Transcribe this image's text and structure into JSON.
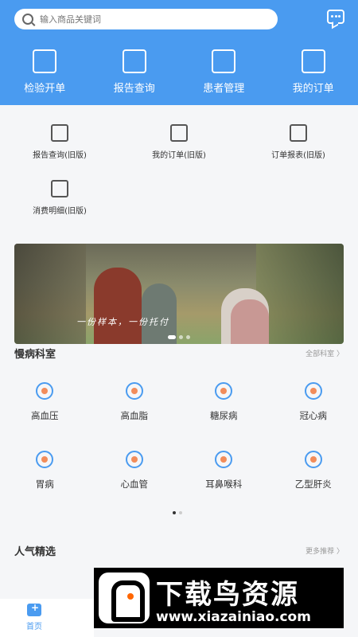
{
  "search": {
    "placeholder": "输入商品关键词"
  },
  "top_nav": [
    {
      "label": "检验开单",
      "icon": "download-box-icon"
    },
    {
      "label": "报告查询",
      "icon": "report-search-icon"
    },
    {
      "label": "患者管理",
      "icon": "layers-icon"
    },
    {
      "label": "我的订单",
      "icon": "checklist-icon"
    }
  ],
  "sub_grid": [
    {
      "label": "报告查询(旧版)",
      "icon": "report-search-icon"
    },
    {
      "label": "我的订单(旧版)",
      "icon": "order-search-icon"
    },
    {
      "label": "订单报表(旧版)",
      "icon": "clipboard-icon"
    },
    {
      "label": "消费明细(旧版)",
      "icon": "yuan-edit-icon"
    }
  ],
  "banner": {
    "slogan": "一份样本，一份托付"
  },
  "chronic": {
    "title": "慢病科室",
    "more": "全部科室 〉",
    "items": [
      {
        "label": "高血压",
        "icon": "stethoscope-icon"
      },
      {
        "label": "高血脂",
        "icon": "blood-drop-icon"
      },
      {
        "label": "糖尿病",
        "icon": "pancreas-icon"
      },
      {
        "label": "冠心病",
        "icon": "heart-icon"
      },
      {
        "label": "胃病",
        "icon": "stomach-icon"
      },
      {
        "label": "心血管",
        "icon": "pulse-icon"
      },
      {
        "label": "耳鼻喉科",
        "icon": "head-icon"
      },
      {
        "label": "乙型肝炎",
        "icon": "liver-icon"
      }
    ]
  },
  "popular": {
    "title": "人气精选",
    "more": "更多推荐 〉"
  },
  "watermark": {
    "title": "下载鸟资源",
    "url": "www.xiazainiao.com"
  },
  "tabbar": {
    "home": "首页"
  },
  "colors": {
    "primary": "#4a9bf0",
    "icon_accent": "#f28c5a"
  }
}
